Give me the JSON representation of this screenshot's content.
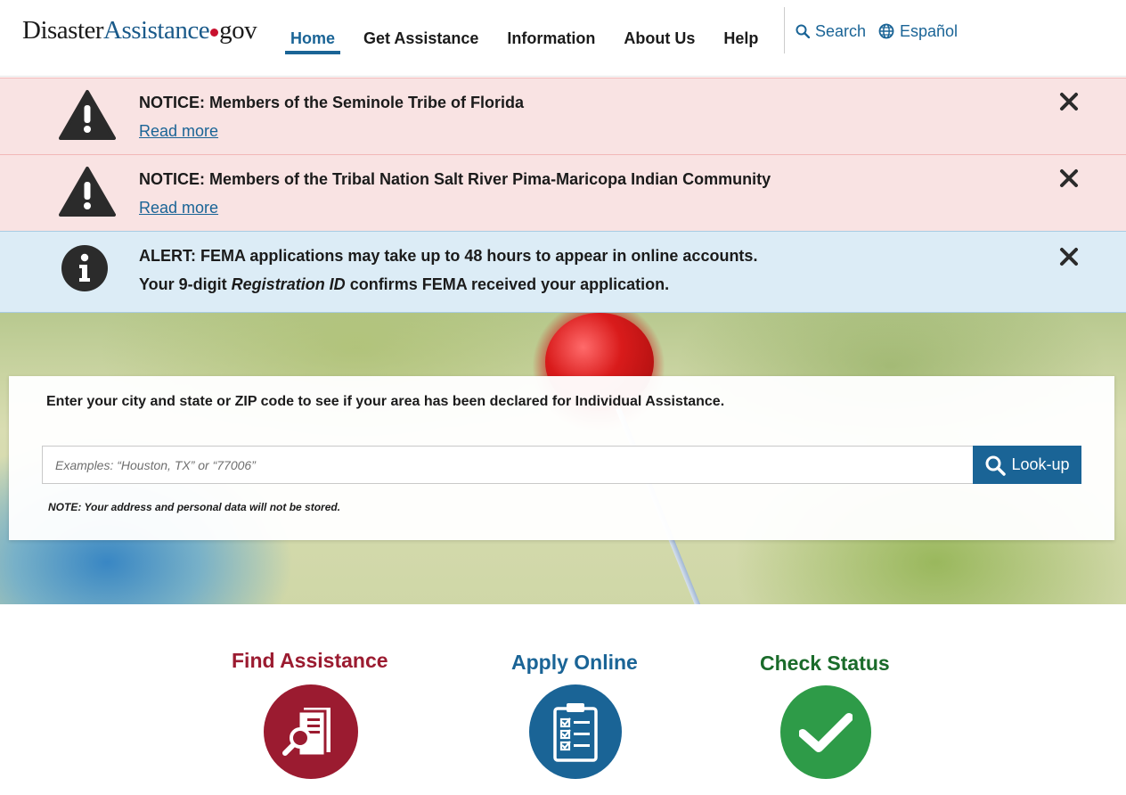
{
  "header": {
    "logo": {
      "part1": "Disaster",
      "part2": "Assistance",
      "part3": "gov"
    },
    "nav": [
      "Home",
      "Get Assistance",
      "Information",
      "About Us",
      "Help"
    ],
    "active_nav": "Home",
    "search_label": "Search",
    "language_label": "Español"
  },
  "notices": [
    {
      "type": "warning",
      "text": "NOTICE: Members of the Seminole Tribe of Florida",
      "link": "Read more"
    },
    {
      "type": "warning",
      "text": "NOTICE: Members of the Tribal Nation Salt River Pima-Maricopa Indian Community",
      "link": "Read more"
    },
    {
      "type": "info",
      "line1": "ALERT: FEMA applications may take up to 48 hours to appear in online accounts.",
      "line2_pre": "Your 9-digit ",
      "line2_em": "Registration ID",
      "line2_post": " confirms FEMA received your application."
    }
  ],
  "lookup": {
    "intro": "Enter your city and state or ZIP code to see if your area has been declared for Individual Assistance.",
    "placeholder": "Examples: “Houston, TX” or “77006”",
    "value": "",
    "button": "Look-up",
    "note": "NOTE: Your address and personal data will not be stored."
  },
  "actions": [
    {
      "title": "Find Assistance",
      "color": "#9b1b30",
      "icon": "document-search-icon"
    },
    {
      "title": "Apply Online",
      "color": "#1a6496",
      "icon": "clipboard-checklist-icon"
    },
    {
      "title": "Check Status",
      "color": "#2e9b48",
      "title_color": "#1a6b2a",
      "icon": "checkmark-icon"
    }
  ],
  "colors": {
    "primary": "#1a6496",
    "warning_bg": "#f9e3e3",
    "info_bg": "#dcecf6",
    "logo_dot": "#c8102e"
  }
}
